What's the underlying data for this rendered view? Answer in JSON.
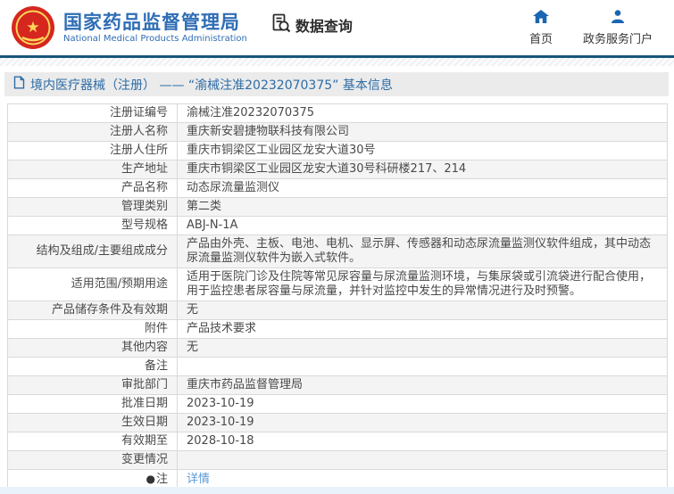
{
  "header": {
    "org_name_zh": "国家药品监督管理局",
    "org_name_en": "National Medical Products Administration",
    "data_query_label": "数据查询",
    "nav_home_label": "首页",
    "nav_portal_label": "政务服务门户"
  },
  "title_bar": {
    "text": "境内医疗器械（注册） —— “渝械注准20232070375” 基本信息"
  },
  "table": {
    "note_icon": "●",
    "rows": [
      {
        "label": "注册证编号",
        "value": "渝械注准20232070375"
      },
      {
        "label": "注册人名称",
        "value": "重庆新安碧捷物联科技有限公司"
      },
      {
        "label": "注册人住所",
        "value": "重庆市铜梁区工业园区龙安大道30号"
      },
      {
        "label": "生产地址",
        "value": "重庆市铜梁区工业园区龙安大道30号科研楼217、214"
      },
      {
        "label": "产品名称",
        "value": "动态尿流量监测仪"
      },
      {
        "label": "管理类别",
        "value": "第二类"
      },
      {
        "label": "型号规格",
        "value": "ABJ-N-1A"
      },
      {
        "label": "结构及组成/主要组成成分",
        "value": "产品由外壳、主板、电池、电机、显示屏、传感器和动态尿流量监测仪软件组成，其中动态尿流量监测仪软件为嵌入式软件。"
      },
      {
        "label": "适用范围/预期用途",
        "value": "适用于医院门诊及住院等常见尿容量与尿流量监测环境，与集尿袋或引流袋进行配合使用，用于监控患者尿容量与尿流量，并针对监控中发生的异常情况进行及时预警。"
      },
      {
        "label": "产品储存条件及有效期",
        "value": "无"
      },
      {
        "label": "附件",
        "value": "产品技术要求"
      },
      {
        "label": "其他内容",
        "value": "无"
      },
      {
        "label": "备注",
        "value": ""
      },
      {
        "label": "审批部门",
        "value": "重庆市药品监督管理局"
      },
      {
        "label": "批准日期",
        "value": "2023-10-19"
      },
      {
        "label": "生效日期",
        "value": "2023-10-19"
      },
      {
        "label": "有效期至",
        "value": "2028-10-18"
      },
      {
        "label": "变更情况",
        "value": ""
      },
      {
        "label": "注",
        "value": "详情"
      }
    ]
  },
  "colors": {
    "brand_blue": "#2f6db5",
    "nav_icon_blue": "#1a66b3",
    "divider_dark": "#17557c",
    "title_bar_bg": "#ebebeb",
    "title_text": "#2d6ca5",
    "row_alt_bg": "#f4f4f4",
    "border": "#d9d9d9",
    "link": "#5b9bd5"
  }
}
